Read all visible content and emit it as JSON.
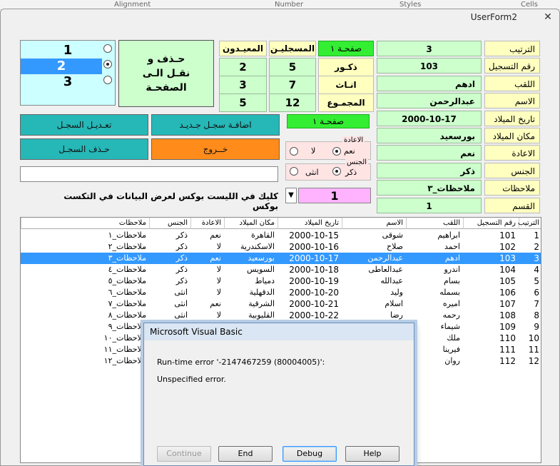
{
  "ribbon": {
    "items": [
      "Alignment",
      "Number",
      "Styles",
      "Cells"
    ]
  },
  "window": {
    "title": "UserForm2",
    "close_glyph": "✕"
  },
  "record_fields": [
    {
      "label": "الترتيب",
      "value": "3"
    },
    {
      "label": "رقم التسجيل",
      "value": "103"
    },
    {
      "label": "اللقب",
      "value": "ادهم"
    },
    {
      "label": "الاسم",
      "value": "عبدالرحمن"
    },
    {
      "label": "تاريخ الميلاد",
      "value": "2000-10-17"
    },
    {
      "label": "مكان الميلاد",
      "value": "بورسعيد"
    },
    {
      "label": "الاعادة",
      "value": "نعم"
    },
    {
      "label": "الجنس",
      "value": "ذكر"
    },
    {
      "label": "ملاحظات",
      "value": "ملاحظات_٣"
    },
    {
      "label": "القسم",
      "value": "1"
    }
  ],
  "stats": {
    "page_label": "صفحـة ١",
    "headers": [
      "المسجليـن",
      "المعيـدون"
    ],
    "rows": [
      {
        "label": "ذكـور",
        "registered": "5",
        "repeaters": "2"
      },
      {
        "label": "انـاث",
        "registered": "7",
        "repeaters": "3"
      },
      {
        "label": "المجمـوع",
        "registered": "12",
        "repeaters": "5"
      }
    ]
  },
  "page_listbox": {
    "items": [
      "1",
      "2",
      "3"
    ],
    "selected": "2"
  },
  "buttons": {
    "delete_move": "حـذف  و\nنقـل  الـى\nالصفحـة",
    "edit_record": "تعـديـل السجـل",
    "add_record": "اضافـة سجـل جـديـد",
    "delete_record": "حـذف السجـل",
    "exit": "خــروج"
  },
  "page2_label": "صفحـة ١",
  "repeat_group": {
    "title": "الاعادة",
    "yes": "نعم",
    "no": "لا"
  },
  "gender_group": {
    "title": "الجنس",
    "male": "ذكر",
    "female": "انثى"
  },
  "hint_text": "كليك في الليست بوكس لعرض البيانات في التكست بوكس",
  "section_combo": {
    "value": "1",
    "arrow": "▼"
  },
  "grid": {
    "headers": [
      "الترتيب",
      "رقم التسجيل",
      "اللقب",
      "الاسم",
      "تاريخ الميلاد",
      "مكان الميلاد",
      "الاعادة",
      "الجنس",
      "ملاحظات"
    ],
    "selected_row": 2,
    "rows": [
      [
        "1",
        "101",
        "ابراهيم",
        "شوقى",
        "2000-10-15",
        "القاهرة",
        "نعم",
        "ذكر",
        "ملاحظات_١"
      ],
      [
        "2",
        "102",
        "احمد",
        "صلاح",
        "2000-10-16",
        "الاسكندرية",
        "لا",
        "ذكر",
        "ملاحظات_٢"
      ],
      [
        "3",
        "103",
        "ادهم",
        "عبدالرحمن",
        "2000-10-17",
        "بورسعيد",
        "نعم",
        "ذكر",
        "ملاحظات_٣"
      ],
      [
        "4",
        "104",
        "اندرو",
        "عبدالعاطى",
        "2000-10-18",
        "السويس",
        "لا",
        "ذكر",
        "ملاحظات_٤"
      ],
      [
        "5",
        "105",
        "بسام",
        "عبدالله",
        "2000-10-19",
        "دمياط",
        "لا",
        "ذكر",
        "ملاحظات_٥"
      ],
      [
        "6",
        "106",
        "بسمله",
        "وليد",
        "2000-10-20",
        "الدقهلية",
        "لا",
        "انثى",
        "ملاحظات_٦"
      ],
      [
        "7",
        "107",
        "اميره",
        "اسلام",
        "2000-10-21",
        "الشرقية",
        "نعم",
        "انثى",
        "ملاحظات_٧"
      ],
      [
        "8",
        "108",
        "رحمه",
        "رضا",
        "2000-10-22",
        "القليوبية",
        "لا",
        "انثى",
        "ملاحظات_٨"
      ],
      [
        "9",
        "109",
        "شيماء",
        "",
        "",
        "",
        "",
        "",
        "ملاحظات_٩"
      ],
      [
        "10",
        "110",
        "ملك",
        "",
        "",
        "",
        "",
        "",
        "ملاحظات_١٠"
      ],
      [
        "11",
        "111",
        "فيرينا",
        "",
        "",
        "",
        "",
        "",
        "ملاحظات_١١"
      ],
      [
        "12",
        "112",
        "روان",
        "",
        "",
        "",
        "",
        "",
        "ملاحظات_١٢"
      ]
    ]
  },
  "dialog": {
    "title": "Microsoft Visual Basic",
    "message": "Run-time error '-2147467259 (80004005)':",
    "detail": "Unspecified error.",
    "buttons": {
      "continue": "Continue",
      "end": "End",
      "debug": "Debug",
      "help": "Help"
    }
  }
}
